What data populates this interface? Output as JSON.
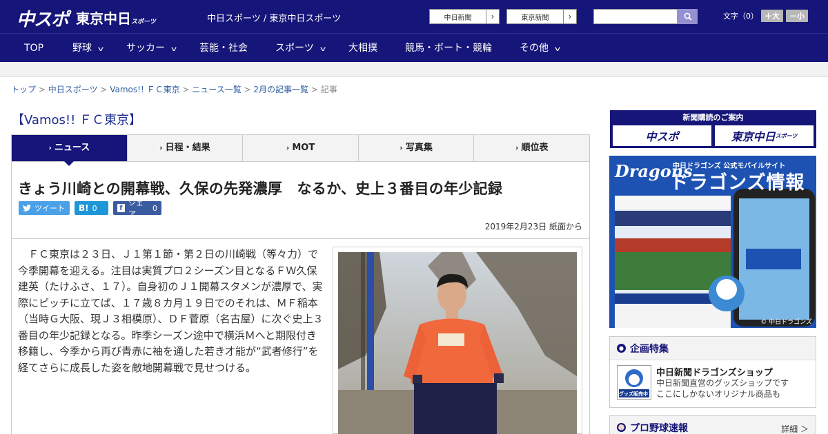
{
  "header": {
    "logo_main": "中スポ",
    "logo_sub": "東京中日",
    "logo_sub_small": "スポーツ",
    "site_names": "中日スポーツ / 東京中日スポーツ",
    "ext_links": [
      "中日新聞",
      "東京新聞"
    ],
    "search_placeholder": "",
    "font_size_label": "文字（0）",
    "font_larger": "＋大",
    "font_smaller": "－小"
  },
  "nav": [
    {
      "label": "TOP",
      "dropdown": false
    },
    {
      "label": "野球",
      "dropdown": true
    },
    {
      "label": "サッカー",
      "dropdown": true
    },
    {
      "label": "芸能・社会",
      "dropdown": false
    },
    {
      "label": "スポーツ",
      "dropdown": true
    },
    {
      "label": "大相撲",
      "dropdown": false
    },
    {
      "label": "競馬・ボート・競輪",
      "dropdown": false
    },
    {
      "label": "その他",
      "dropdown": true
    }
  ],
  "breadcrumb": {
    "items": [
      "トップ",
      "中日スポーツ",
      "Vamos!! ＦＣ東京",
      "ニュース一覧",
      "2月の記事一覧"
    ],
    "current": "記事",
    "separator": ">"
  },
  "category_title": "【Vamos!! ＦＣ東京】",
  "tabs": [
    {
      "label": "ニュース",
      "active": true
    },
    {
      "label": "日程・結果",
      "active": false
    },
    {
      "label": "MOT",
      "active": false
    },
    {
      "label": "写真集",
      "active": false
    },
    {
      "label": "順位表",
      "active": false
    }
  ],
  "article": {
    "headline": "きょう川崎との開幕戦、久保の先発濃厚　なるか、史上３番目の年少記録",
    "share": {
      "tweet": "ツイート",
      "hatena_label": "B!",
      "hatena_count": "0",
      "facebook": "シェア",
      "facebook_count": "0"
    },
    "dateline": "2019年2月23日 紙面から",
    "body": "ＦＣ東京は２３日、Ｊ１第１節・第２日の川崎戦（等々力）で今季開幕を迎える。注目は実質プロ２シーズン目となるＦＷ久保建英（たけふさ、１７）。自身初のＪ１開幕スタメンが濃厚で、実際にピッチに立てば、１７歳８カ月１９日でのそれは、ＭＦ稲本（当時Ｇ大阪、現Ｊ３相模原）、ＤＦ菅原（名古屋）に次ぐ史上３番目の年少記録となる。昨季シーズン途中で横浜Ｍへと期限付き移籍し、今季から再び青赤に袖を通した若き才能が“武者修行”を経てさらに成長した姿を敵地開幕戦で見せつける。"
  },
  "sidebar": {
    "promo_title": "新聞購読のご案内",
    "promo_buttons": [
      "中スポ",
      "東京中日"
    ],
    "promo_button_small": "スポーツ",
    "dragons_logo": "Dragons",
    "dragons_sub": "中日ドラゴンズ 公式モバイルサイト",
    "dragons_title": "ドラゴンズ情報",
    "dragons_copy": "© 中日ドラゴンズ",
    "feature_title": "企画特集",
    "shop_thumb_text": "グッズ販売中",
    "shop_name": "中日新聞ドラゴンズショップ",
    "shop_desc": [
      "中日新聞直営のグッズショップです",
      "ここにしかないオリジナル商品も"
    ],
    "baseball_title": "プロ野球速報",
    "baseball_more": "詳細 ＞"
  },
  "colors": {
    "brand": "#161579",
    "link": "#2f5ea0",
    "twitter": "#4aa1e8",
    "hatena": "#1e96d7",
    "facebook": "#3b5ba0"
  }
}
